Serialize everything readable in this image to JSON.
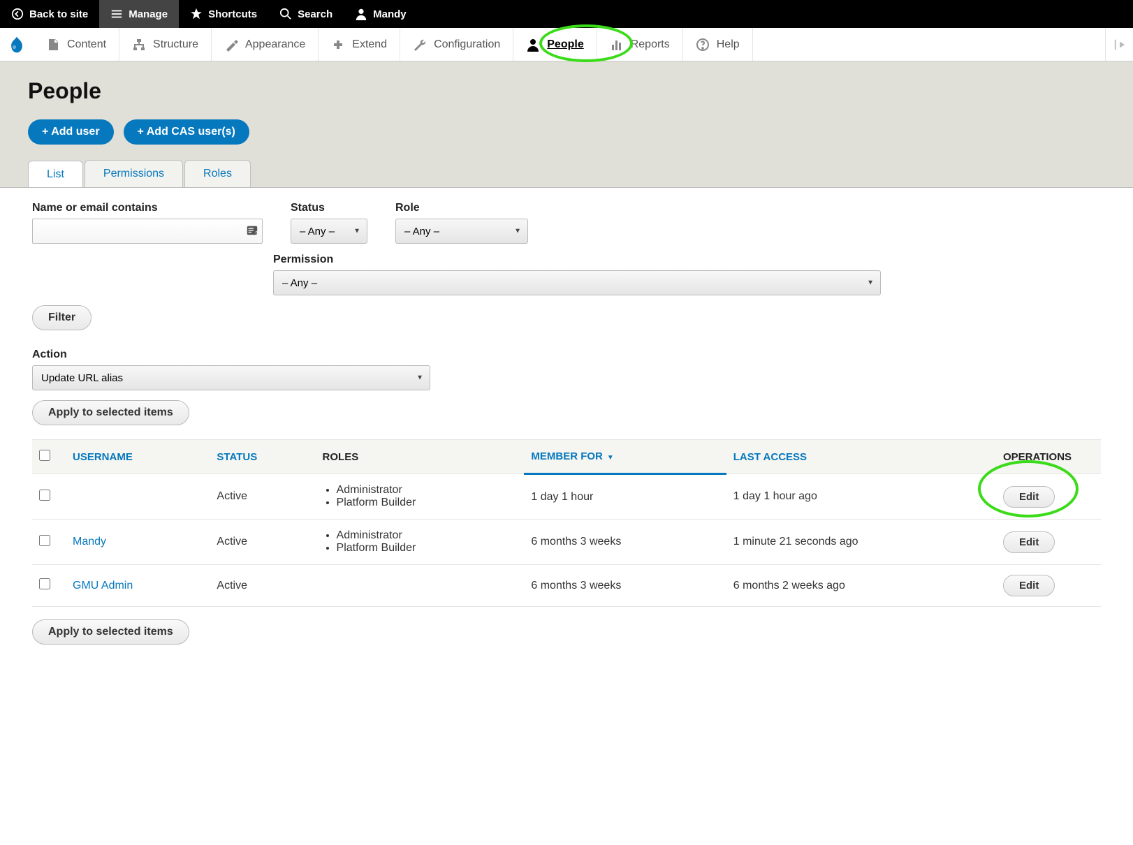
{
  "topbar": {
    "back": "Back to site",
    "manage": "Manage",
    "shortcuts": "Shortcuts",
    "search": "Search",
    "user": "Mandy"
  },
  "adminbar": {
    "items": [
      "Content",
      "Structure",
      "Appearance",
      "Extend",
      "Configuration",
      "People",
      "Reports",
      "Help"
    ]
  },
  "page": {
    "title": "People",
    "add_user": "+ Add user",
    "add_cas_user": "+ Add CAS user(s)"
  },
  "tabs": [
    "List",
    "Permissions",
    "Roles"
  ],
  "filters": {
    "name_label": "Name or email contains",
    "name_value": "",
    "status_label": "Status",
    "status_value": "– Any –",
    "role_label": "Role",
    "role_value": "– Any –",
    "permission_label": "Permission",
    "permission_value": "– Any –",
    "filter_btn": "Filter"
  },
  "action": {
    "label": "Action",
    "value": "Update URL alias",
    "apply_btn": "Apply to selected items"
  },
  "table": {
    "columns": [
      "USERNAME",
      "STATUS",
      "ROLES",
      "MEMBER FOR",
      "LAST ACCESS",
      "OPERATIONS"
    ],
    "rows": [
      {
        "username": "",
        "status": "Active",
        "roles": [
          "Administrator",
          "Platform Builder"
        ],
        "member_for": "1 day 1 hour",
        "last_access": "1 day 1 hour ago",
        "edit": "Edit"
      },
      {
        "username": "Mandy",
        "status": "Active",
        "roles": [
          "Administrator",
          "Platform Builder"
        ],
        "member_for": "6 months 3 weeks",
        "last_access": "1 minute 21 seconds ago",
        "edit": "Edit"
      },
      {
        "username": "GMU Admin",
        "status": "Active",
        "roles": [],
        "member_for": "6 months 3 weeks",
        "last_access": "6 months 2 weeks ago",
        "edit": "Edit"
      }
    ]
  },
  "apply_bottom": "Apply to selected items"
}
